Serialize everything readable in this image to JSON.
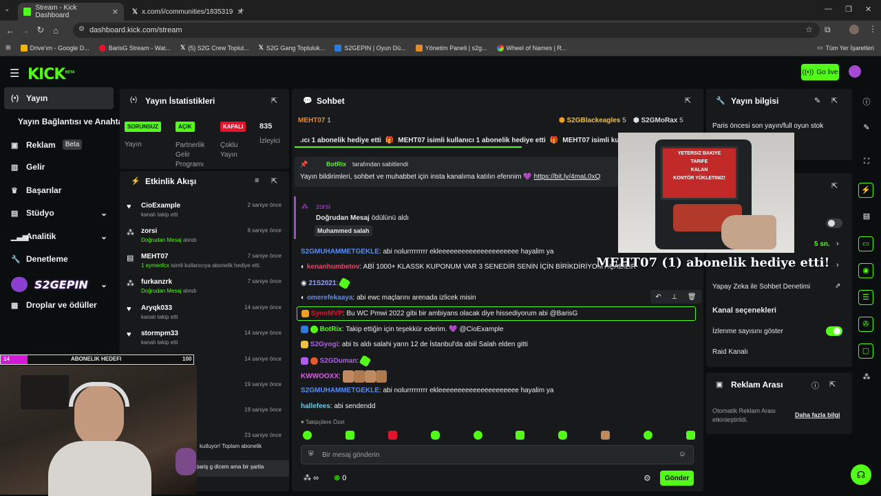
{
  "browser": {
    "tabs": [
      {
        "title": "Stream - Kick Dashboard",
        "active": true
      },
      {
        "title": "x.com/i/communities/1835319",
        "active": false
      }
    ],
    "url": "dashboard.kick.com/stream",
    "bookmarks": [
      "Drive'ım - Google D...",
      "BarisG Stream - Wat...",
      "(5) S2G Crew Toplul...",
      "S2G Gang Topluluk...",
      "S2GEPIN | Oyun Dü...",
      "Yönetim Paneli | s2g...",
      "Wheel of Names | R..."
    ],
    "all_bookmarks": "Tüm Yer İşaretleri"
  },
  "kick": {
    "logo": "KICK",
    "logo_beta": "BETA",
    "go_live": "Go live",
    "accent": "#53fc18"
  },
  "sidebar": {
    "items": [
      {
        "label": "Yayın",
        "icon": "broadcast-icon"
      },
      {
        "label": "Yayın Bağlantısı ve Anahtarı",
        "icon": "key-icon"
      },
      {
        "label": "Reklam",
        "icon": "ad-icon",
        "tag": "Beta"
      },
      {
        "label": "Gelir",
        "icon": "revenue-icon"
      },
      {
        "label": "Başarılar",
        "icon": "trophy-icon"
      },
      {
        "label": "Stüdyo",
        "icon": "studio-icon"
      },
      {
        "label": "Analitik",
        "icon": "analytics-icon"
      },
      {
        "label": "Denetleme",
        "icon": "wrench-icon"
      },
      {
        "label": "S2GEPIN",
        "icon": "logo-overlay"
      },
      {
        "label": "Droplar ve ödüller",
        "icon": "gift-icon"
      }
    ]
  },
  "stats": {
    "title": "Yayın İstatistikleri",
    "items": [
      {
        "badge": "SORUNSUZ",
        "label": "Yayın",
        "color": "#53fc18"
      },
      {
        "badge": "AÇIK",
        "label": "Partnerlik Gelir Programı",
        "color": "#53fc18"
      },
      {
        "badge": "KAPALI",
        "label": "Çoklu Yayın",
        "color": "#e5132b"
      },
      {
        "badge": "835",
        "label": "İzleyici"
      }
    ]
  },
  "activity": {
    "title": "Etkinlik Akışı",
    "events": [
      {
        "name": "CioExample",
        "sub": "kanalı takip etti",
        "time": "2 saniye önce",
        "icon": "heart-icon"
      },
      {
        "name": "zorsi",
        "sub": "Doğrudan Mesaj",
        "sub2": "alındı",
        "time": "6 saniye önce",
        "icon": "dm-icon"
      },
      {
        "name": "MEHT07",
        "sub": "1 eymenfcx",
        "sub2": "isimli kullanıcıya abonelik hediye etti.",
        "time": "7 saniye önce",
        "icon": "gift-sub-icon"
      },
      {
        "name": "furkanzrk",
        "sub": "Doğrudan Mesaj",
        "sub2": "alındı",
        "time": "7 saniye önce",
        "icon": "dm-icon"
      },
      {
        "name": "Aryqk033",
        "sub": "kanalı takip etti",
        "time": "14 saniye önce",
        "icon": "heart-icon"
      },
      {
        "name": "stormpm33",
        "sub": "kanalı takip etti",
        "time": "14 saniye önce",
        "icon": "heart-icon"
      },
      {
        "name": "menzer1",
        "sub": "",
        "time": "14 saniye önce",
        "icon": "heart-icon"
      },
      {
        "name": "",
        "sub": "",
        "time": "19 saniye önce",
        "icon": ""
      },
      {
        "name": "",
        "sub": "",
        "time": "19 saniye önce",
        "icon": ""
      },
      {
        "name": "",
        "sub": "kutluyor! Toplam abonelik",
        "time": "23 saniye önce",
        "icon": ""
      }
    ],
    "last_text": "bariş g dicem ama bir şartla"
  },
  "subgoal": {
    "label": "ABONELIK HEDEFI",
    "current": "14",
    "target": "100",
    "progress": 0.14
  },
  "chat": {
    "title": "Sohbet",
    "top_gifters": [
      {
        "name": "MEHT07",
        "count": "1"
      },
      {
        "name": "S2GBlackeagles",
        "count": "5"
      },
      {
        "name": "S2GMoRax",
        "count": "5"
      }
    ],
    "gift_banner": [
      ".ıcı 1 abonelik hediye etti",
      "MEHT07 isimli kullanıcı 1 abonelik hediye etti",
      "MEHT07 isimli kullanıcı 1 abonelik hediy"
    ],
    "pinned": {
      "by": "BotRix",
      "by_suffix": "tarafından sabitlendi",
      "text": "Yayın bildirimleri, sohbet ve muhabbet için insta kanalıma katılın efennim 💜",
      "link": "https://bit.ly/4maL0xQ"
    },
    "reward": {
      "user": "zorsi",
      "title": "Doğrudan Mesaj",
      "title_suffix": "ödülünü aldı",
      "tag": "Muhammed salah"
    },
    "messages": [
      {
        "user": "S2GMUHAMMETGEKLE",
        "color": "#5b8def",
        "text": "abi nolurrrrrrrrr ekleeeeeeeeeeeeeeeeeeeee hayalim ya"
      },
      {
        "user": "kenanhumbetov",
        "color": "#e04a6a",
        "text": "ABİ 1000+ KLASSK KUPONUM VAR 3 SENEDİR SENİN İÇİN BİRİKDİRİYOM AÇABİLİR"
      },
      {
        "user": "21S2021",
        "color": "#9aa0ff",
        "text": ""
      },
      {
        "user": "omerefekaaya",
        "color": "#5b8def",
        "text": "abi ewc maçlarını arenada izlicek misin"
      },
      {
        "user": "SynoMVP",
        "color": "#e5132b",
        "text": "Bu WC Pmwi 2022 gibi bir ambiyans olacak diye hissediyorum abi @BarisG",
        "highlight": true
      },
      {
        "user": "BotRix",
        "color": "#53fc18",
        "text": "Takip ettiğin için teşekkür ederim. 💜 @CioExample"
      },
      {
        "user": "S2Gyogi",
        "color": "#b05cf0",
        "text": "abi ts aldı salahi yarın 12 de İstanbul'da abiil Salah elden gitti"
      },
      {
        "user": "S2GDuman",
        "color": "#b05cf0",
        "text": ""
      },
      {
        "user": "KWWOOXX",
        "color": "#e05cf0",
        "text": ""
      },
      {
        "user": "S2GMUHAMMETGEKLE",
        "color": "#5b8def",
        "text": "abi nolurrrrrrrrr ekleeeeeeeeeeeeeeeeeeeee hayalim ya"
      },
      {
        "user": "hallefees",
        "color": "#5bd3f0",
        "text": "abi sendendd"
      }
    ],
    "followers_only": "Takipçilere Özel",
    "input_placeholder": "Bir mesaj gönderin",
    "send": "Gönder",
    "infinity": "∞",
    "points": "0"
  },
  "overlay": {
    "alert_text": "MEHT07 (1) abonelik hediye etti!",
    "sign_lines": [
      "YETERSIZ BAKIYE",
      "TARIFE",
      "KALAN",
      "KONTÖR YÜKLETINIZ!"
    ]
  },
  "info": {
    "title": "Yayın bilgisi",
    "stream_title": "Paris öncesi son yayın/full oyun stok",
    "slow_mode_value": "5 sn.",
    "ai_moderation": "Yapay Zeka ile Sohbet Denetimi",
    "channel_options": "Kanal seçenekleri",
    "show_viewers": "İzlenme sayısını göster",
    "raid": "Raid Kanalı",
    "ad_break_title": "Reklam Arası",
    "ad_break_text": "Otomatik Reklam Arası etkinleştirildi.",
    "learn_more": "Daha fazla bilgi"
  }
}
